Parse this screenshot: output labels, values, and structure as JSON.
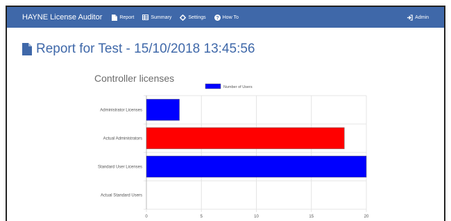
{
  "navbar": {
    "brand": "HAYNE License Auditor",
    "items": [
      {
        "label": "Report",
        "icon": "file-icon"
      },
      {
        "label": "Summary",
        "icon": "table-icon"
      },
      {
        "label": "Settings",
        "icon": "gear-icon"
      },
      {
        "label": "How To",
        "icon": "question-icon"
      }
    ],
    "user": {
      "label": "Admin",
      "icon": "sign-in-icon"
    },
    "color": "#3f68a9"
  },
  "page": {
    "title": "Report for Test - 15/10/2018 13:45:56",
    "title_icon": "file-icon"
  },
  "chart_data": {
    "type": "bar",
    "orientation": "horizontal",
    "title": "Controller licenses",
    "categories": [
      "Administrator Licenses",
      "Actual Administrators",
      "Standard User Licenses",
      "Actual Standard Users"
    ],
    "series": [
      {
        "name": "Number of Users",
        "values": [
          3,
          18,
          20,
          0
        ],
        "colors": [
          "#0000ff",
          "#ff0000",
          "#0000ff",
          "#0000ff"
        ]
      }
    ],
    "xlim": [
      0,
      20
    ],
    "xticks": [
      0,
      5,
      10,
      15,
      20
    ],
    "grid": true,
    "legend": "top"
  }
}
